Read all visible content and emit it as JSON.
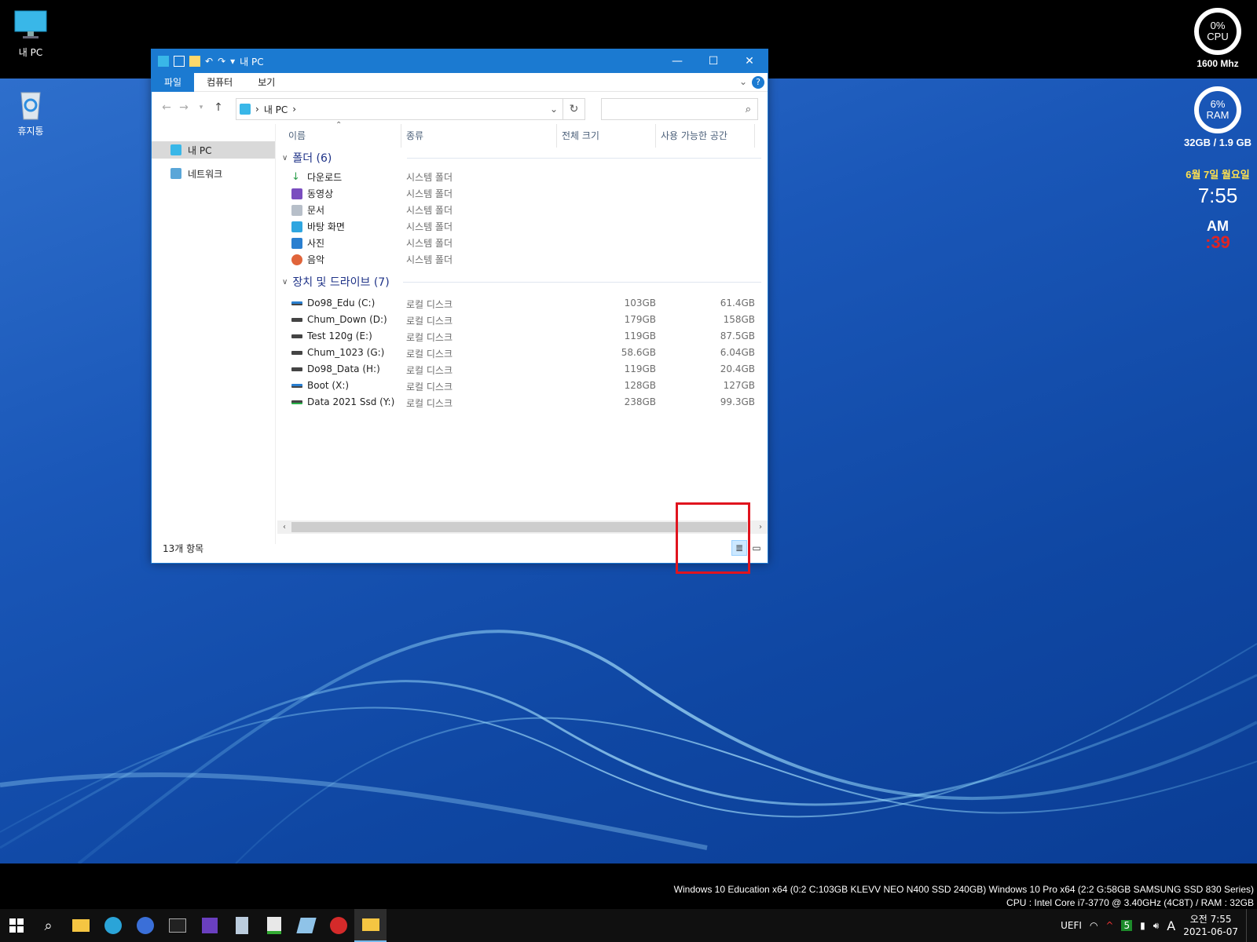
{
  "desktop": {
    "icons": [
      {
        "label": "내 PC",
        "icon": "computer-icon"
      },
      {
        "label": "휴지통",
        "icon": "recycle-bin-icon"
      }
    ]
  },
  "gadgets": {
    "cpu_percent": "0%",
    "cpu_label": "CPU",
    "cpu_freq": "1600 Mhz",
    "ram_percent": "6%",
    "ram_label": "RAM",
    "ram_info": "32GB / 1.9 GB",
    "date": "6월 7일 월요일",
    "time": "7:55",
    "ampm": "AM",
    "seconds": ":39"
  },
  "window": {
    "title": "내 PC",
    "tabs": [
      "파일",
      "컴퓨터",
      "보기"
    ],
    "address": "내 PC",
    "nav": [
      "내 PC",
      "네트워크"
    ],
    "columns": [
      "이름",
      "종류",
      "전체 크기",
      "사용 가능한 공간"
    ],
    "folders_group": "폴더 (6)",
    "folders": [
      {
        "name": "다운로드",
        "type": "시스템 폴더"
      },
      {
        "name": "동영상",
        "type": "시스템 폴더"
      },
      {
        "name": "문서",
        "type": "시스템 폴더"
      },
      {
        "name": "바탕 화면",
        "type": "시스템 폴더"
      },
      {
        "name": "사진",
        "type": "시스템 폴더"
      },
      {
        "name": "음악",
        "type": "시스템 폴더"
      }
    ],
    "drives_group": "장치 및 드라이브 (7)",
    "drives": [
      {
        "name": "Do98_Edu (C:)",
        "type": "로컬 디스크",
        "total": "103GB",
        "free": "61.4GB"
      },
      {
        "name": "Chum_Down (D:)",
        "type": "로컬 디스크",
        "total": "179GB",
        "free": "158GB"
      },
      {
        "name": "Test 120g (E:)",
        "type": "로컬 디스크",
        "total": "119GB",
        "free": "87.5GB"
      },
      {
        "name": "Chum_1023 (G:)",
        "type": "로컬 디스크",
        "total": "58.6GB",
        "free": "6.04GB"
      },
      {
        "name": "Do98_Data (H:)",
        "type": "로컬 디스크",
        "total": "119GB",
        "free": "20.4GB"
      },
      {
        "name": "Boot (X:)",
        "type": "로컬 디스크",
        "total": "128GB",
        "free": "127GB"
      },
      {
        "name": "Data 2021 Ssd (Y:)",
        "type": "로컬 디스크",
        "total": "238GB",
        "free": "99.3GB"
      }
    ],
    "status_count": "13개 항목"
  },
  "sysinfo": {
    "line1": "Windows 10 Education x64 (0:2 C:103GB KLEVV NEO N400 SSD 240GB) Windows 10 Pro x64 (2:2 G:58GB SAMSUNG SSD 830 Series)",
    "line2": "CPU : Intel Core i7-3770 @ 3.40GHz (4C8T) / RAM : 32GB"
  },
  "taskbar": {
    "tray_uefi": "UEFI",
    "tray_badge": "5",
    "ime": "A",
    "clock_time": "오전 7:55",
    "clock_date": "2021-06-07"
  },
  "colors": {
    "accent": "#1b7ad1",
    "highlight": "#e0141e"
  }
}
